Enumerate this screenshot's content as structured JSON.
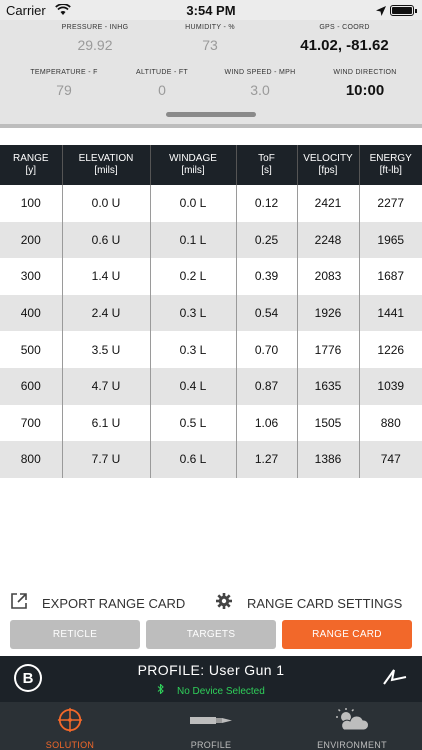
{
  "status_bar": {
    "carrier": "Carrier",
    "time": "3:54 PM"
  },
  "environment": {
    "pressure": {
      "label": "PRESSURE - INHG",
      "value": "29.92"
    },
    "humidity": {
      "label": "HUMIDITY - %",
      "value": "73"
    },
    "gps": {
      "label": "GPS - COORD",
      "value": "41.02, -81.62"
    },
    "temperature": {
      "label": "TEMPERATURE - F",
      "value": "79"
    },
    "altitude": {
      "label": "ALTITUDE - FT",
      "value": "0"
    },
    "wind_speed": {
      "label": "WIND SPEED - MPH",
      "value": "3.0"
    },
    "wind_direction": {
      "label": "WIND DIRECTION",
      "value": "10:00"
    }
  },
  "table": {
    "headers": [
      {
        "line1": "RANGE",
        "line2": "[y]"
      },
      {
        "line1": "ELEVATION",
        "line2": "[mils]"
      },
      {
        "line1": "WINDAGE",
        "line2": "[mils]"
      },
      {
        "line1": "ToF",
        "line2": "[s]"
      },
      {
        "line1": "VELOCITY",
        "line2": "[fps]"
      },
      {
        "line1": "ENERGY",
        "line2": "[ft-lb]"
      }
    ],
    "rows": [
      [
        "100",
        "0.0 U",
        "0.0 L",
        "0.12",
        "2421",
        "2277"
      ],
      [
        "200",
        "0.6 U",
        "0.1 L",
        "0.25",
        "2248",
        "1965"
      ],
      [
        "300",
        "1.4 U",
        "0.2 L",
        "0.39",
        "2083",
        "1687"
      ],
      [
        "400",
        "2.4 U",
        "0.3 L",
        "0.54",
        "1926",
        "1441"
      ],
      [
        "500",
        "3.5 U",
        "0.3 L",
        "0.70",
        "1776",
        "1226"
      ],
      [
        "600",
        "4.7 U",
        "0.4 L",
        "0.87",
        "1635",
        "1039"
      ],
      [
        "700",
        "6.1 U",
        "0.5 L",
        "1.06",
        "1505",
        "880"
      ],
      [
        "800",
        "7.7 U",
        "0.6 L",
        "1.27",
        "1386",
        "747"
      ]
    ]
  },
  "actions": {
    "export_label": "EXPORT RANGE CARD",
    "settings_label": "RANGE CARD SETTINGS"
  },
  "tabs": {
    "reticle": "RETICLE",
    "targets": "TARGETS",
    "range_card": "RANGE CARD",
    "active": "range_card",
    "active_color": "#f2682a"
  },
  "profile": {
    "logo_letter": "B",
    "title": "PROFILE: User Gun 1",
    "device_status": "No Device Selected",
    "device_status_color": "#2fcf5a"
  },
  "bottom_nav": {
    "solution": "SOLUTION",
    "profile": "PROFILE",
    "environment": "ENVIRONMENT",
    "active": "solution"
  },
  "icons": {
    "status": [
      "wifi-icon",
      "location-arrow-icon",
      "battery-icon"
    ],
    "actions": [
      "export-icon",
      "gear-icon"
    ],
    "profile": [
      "bushnell-logo-icon",
      "bluetooth-icon",
      "signal-logo-icon"
    ],
    "nav": [
      "crosshair-icon",
      "bullet-icon",
      "weather-icon"
    ]
  }
}
